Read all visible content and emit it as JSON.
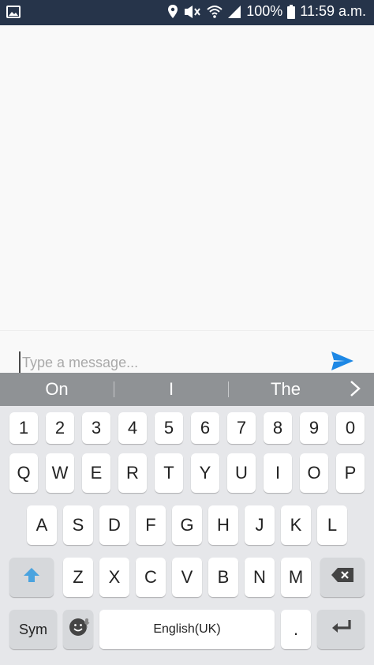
{
  "status_bar": {
    "battery_percent": "100%",
    "time": "11:59 a.m."
  },
  "chat": {
    "input_placeholder": "Type a message..."
  },
  "suggestions": [
    "On",
    "I",
    "The"
  ],
  "keyboard": {
    "number_row": [
      "1",
      "2",
      "3",
      "4",
      "5",
      "6",
      "7",
      "8",
      "9",
      "0"
    ],
    "row1": [
      "Q",
      "W",
      "E",
      "R",
      "T",
      "Y",
      "U",
      "I",
      "O",
      "P"
    ],
    "row2": [
      "A",
      "S",
      "D",
      "F",
      "G",
      "H",
      "J",
      "K",
      "L"
    ],
    "row3": [
      "Z",
      "X",
      "C",
      "V",
      "B",
      "N",
      "M"
    ],
    "sym_label": "Sym",
    "space_label": "English(UK)",
    "period_label": "."
  },
  "colors": {
    "status_bar_bg": "#26344a",
    "send_icon": "#1e88e5",
    "shift_icon": "#4aa3df"
  },
  "icons": [
    "image-icon",
    "location-icon",
    "mute-icon",
    "wifi-icon",
    "signal-icon",
    "battery-icon",
    "send-icon",
    "chevron-right-icon",
    "shift-icon",
    "backspace-icon",
    "emoji-icon",
    "mic-icon",
    "enter-icon"
  ]
}
